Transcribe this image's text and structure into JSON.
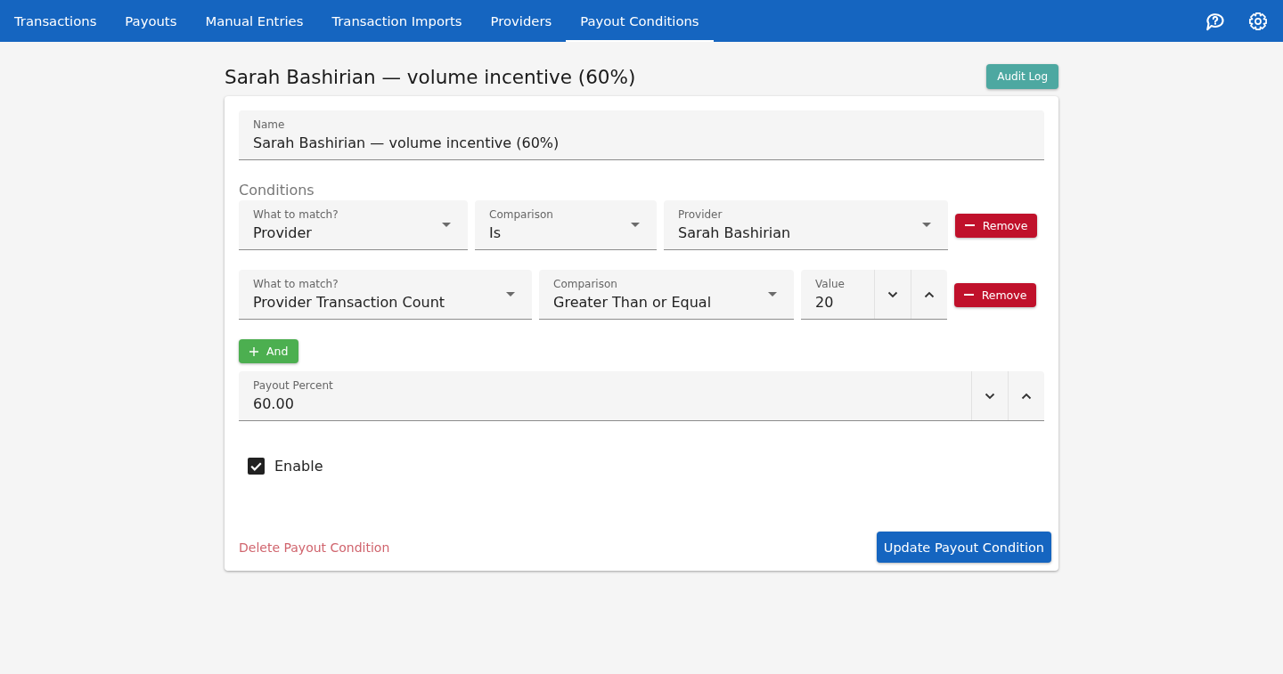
{
  "nav": {
    "tabs": [
      {
        "label": "Transactions",
        "selected": false
      },
      {
        "label": "Payouts",
        "selected": false
      },
      {
        "label": "Manual Entries",
        "selected": false
      },
      {
        "label": "Transaction Imports",
        "selected": false
      },
      {
        "label": "Providers",
        "selected": false
      },
      {
        "label": "Payout Conditions",
        "selected": true
      }
    ]
  },
  "header": {
    "title": "Sarah Bashirian — volume incentive (60%)",
    "audit_log_button": "Audit Log"
  },
  "form": {
    "name": {
      "label": "Name",
      "value": "Sarah Bashirian — volume incentive (60%)"
    },
    "conditions_label": "Conditions",
    "conditions": [
      {
        "fields": [
          {
            "kind": "select",
            "label": "What to match?",
            "value": "Provider"
          },
          {
            "kind": "select",
            "label": "Comparison",
            "value": "Is"
          },
          {
            "kind": "select",
            "label": "Provider",
            "value": "Sarah Bashirian"
          }
        ],
        "remove_button": "Remove"
      },
      {
        "fields": [
          {
            "kind": "select",
            "label": "What to match?",
            "value": "Provider Transaction Count"
          },
          {
            "kind": "select",
            "label": "Comparison",
            "value": "Greater Than or Equal"
          },
          {
            "kind": "number",
            "label": "Value",
            "value": "20"
          }
        ],
        "remove_button": "Remove"
      }
    ],
    "and_button": "And",
    "payout_percent": {
      "kind": "number",
      "label": "Payout Percent",
      "value": "60.00"
    },
    "enable": {
      "label": "Enable",
      "checked": true
    },
    "delete_link": "Delete Payout Condition",
    "update_button": "Update Payout Condition"
  }
}
